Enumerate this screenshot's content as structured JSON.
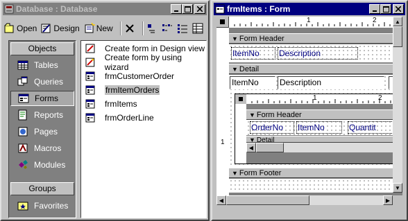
{
  "db_window": {
    "title": "Database : Database",
    "toolbar": {
      "open_label": "Open",
      "design_label": "Design",
      "new_label": "New"
    },
    "objects_header": "Objects",
    "groups_header": "Groups",
    "objects": [
      {
        "label": "Tables",
        "icon": "table-icon"
      },
      {
        "label": "Queries",
        "icon": "query-icon"
      },
      {
        "label": "Forms",
        "icon": "form-icon"
      },
      {
        "label": "Reports",
        "icon": "report-icon"
      },
      {
        "label": "Pages",
        "icon": "page-icon"
      },
      {
        "label": "Macros",
        "icon": "macro-icon"
      },
      {
        "label": "Modules",
        "icon": "module-icon"
      }
    ],
    "selected_object": "Forms",
    "groups": [
      {
        "label": "Favorites",
        "icon": "favorites-icon"
      }
    ],
    "list_items": [
      {
        "label": "Create form in Design view",
        "icon": "create-form-icon"
      },
      {
        "label": "Create form by using wizard",
        "icon": "wizard-icon"
      },
      {
        "label": "frmCustomerOrder",
        "icon": "form-icon"
      },
      {
        "label": "frmItemOrders",
        "icon": "form-icon"
      },
      {
        "label": "frmItems",
        "icon": "form-icon"
      },
      {
        "label": "frmOrderLine",
        "icon": "form-icon"
      }
    ],
    "selected_item": "frmItemOrders"
  },
  "form_window": {
    "title": "frmItems : Form",
    "ruler_marks": [
      "1",
      "2"
    ],
    "form_header_label": "Form Header",
    "header_labels": [
      "ItemNo",
      "Description"
    ],
    "detail_label": "Detail",
    "detail_fields": [
      "ItemNo",
      "Description"
    ],
    "subform": {
      "ruler_marks": [
        "1",
        "2"
      ],
      "form_header_label": "Form Header",
      "header_labels": [
        "OrderNo",
        "ItemNo",
        "Quantit"
      ],
      "detail_label": "Detail"
    },
    "form_footer_label": "Form Footer",
    "vertical_ruler_mark": "1"
  },
  "colors": {
    "active_title": "#000080",
    "inactive_title": "#808080",
    "label_text": "#000080",
    "face": "#c0c0c0"
  }
}
